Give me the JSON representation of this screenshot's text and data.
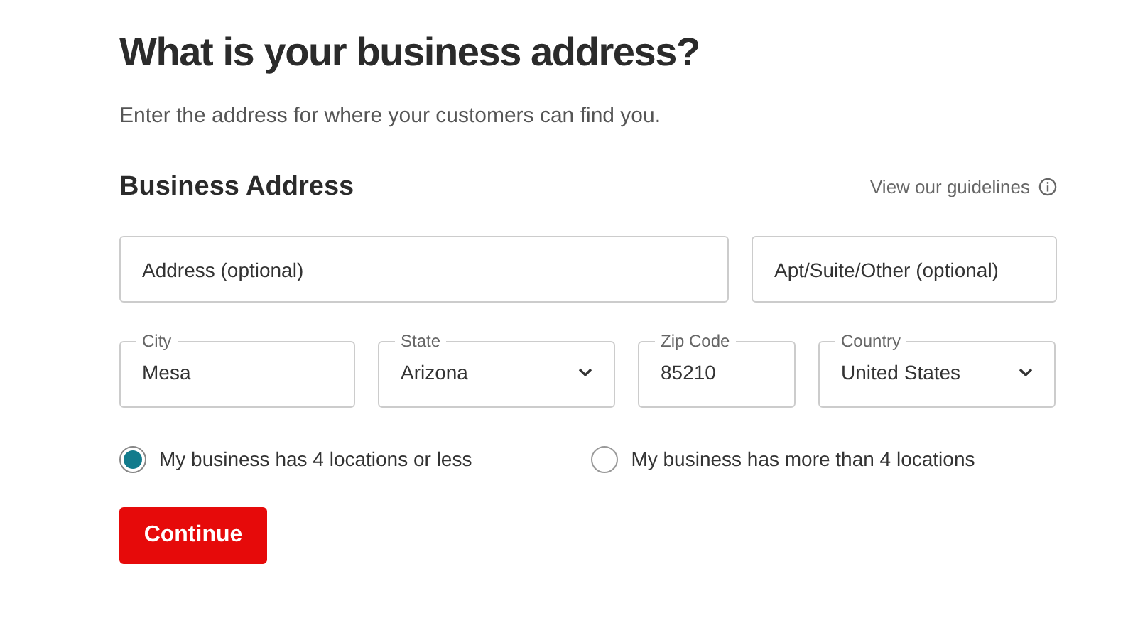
{
  "title": "What is your business address?",
  "subtitle": "Enter the address for where your customers can find you.",
  "section": {
    "heading": "Business Address",
    "link": "View our guidelines"
  },
  "address_fields": [
    {
      "kind": "input",
      "placeholder": "Address (optional)"
    },
    {
      "kind": "input",
      "placeholder": "Apt/Suite/Other (optional)"
    }
  ],
  "detail_fields": [
    {
      "kind": "input",
      "label": "City",
      "value": "Mesa"
    },
    {
      "kind": "select",
      "label": "State",
      "value": "Arizona"
    },
    {
      "kind": "input",
      "label": "Zip Code",
      "value": "85210"
    },
    {
      "kind": "select",
      "label": "Country",
      "value": "United States"
    }
  ],
  "location_options": [
    {
      "label": "My business has 4 locations or less",
      "selected": true
    },
    {
      "label": "My business has more than 4 locations",
      "selected": false
    }
  ],
  "button": "Continue"
}
